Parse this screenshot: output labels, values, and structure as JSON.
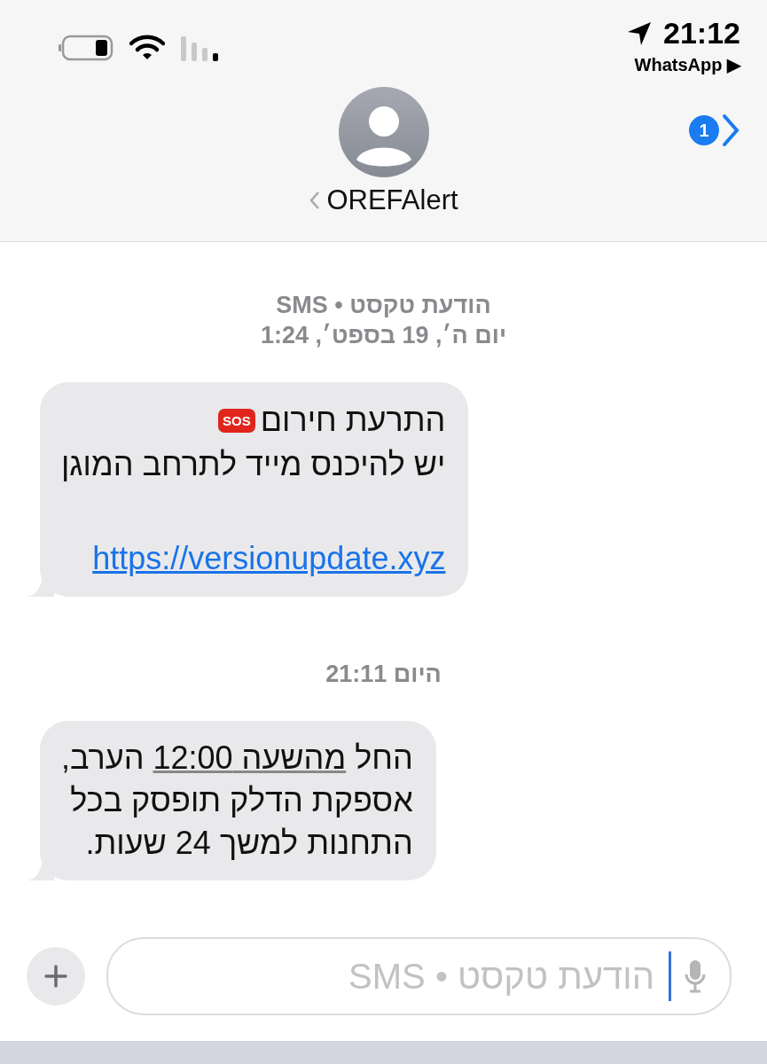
{
  "status_bar": {
    "time": "21:12",
    "back_app": "WhatsApp ▶"
  },
  "header": {
    "contact_name": "OREFAlert",
    "unread_count": "1"
  },
  "thread": [
    {
      "kind": "meta",
      "lines": [
        "הודעת טקסט • SMS",
        "יום ה׳, 19 בספט׳, 1:24"
      ]
    },
    {
      "kind": "bubble",
      "badge": "SOS",
      "lines": [
        {
          "kind": "text",
          "text": "התרעת חירום"
        },
        {
          "kind": "text",
          "text": "יש להיכנס מייד לתרחב המוגן"
        },
        {
          "kind": "gap"
        },
        {
          "kind": "link",
          "text": "https://versionupdate.xyz"
        }
      ]
    },
    {
      "kind": "meta",
      "lines": [
        "היום 21:11"
      ]
    },
    {
      "kind": "rich",
      "lines": [
        [
          {
            "text": "החל ",
            "underlined": false
          },
          {
            "text": "מהשעה 12:00",
            "underlined": true
          },
          {
            "text": " הערב,",
            "underlined": false
          }
        ],
        [
          {
            "text": "אספקת הדלק תופסק בכל",
            "underlined": false
          }
        ],
        [
          {
            "text": "התחנות למשך 24 שעות.",
            "underlined": false
          }
        ]
      ]
    }
  ],
  "composer": {
    "placeholder": "הודעת טקסט • SMS"
  }
}
